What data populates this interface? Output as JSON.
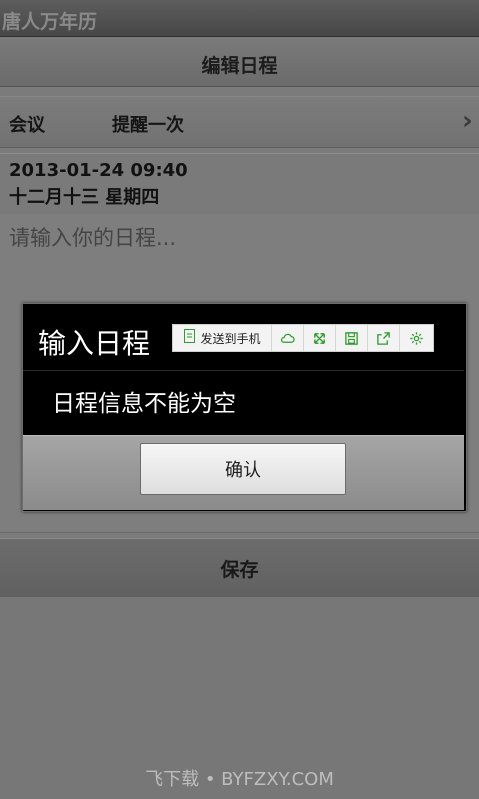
{
  "app": {
    "title": "唐人万年历"
  },
  "header": {
    "title": "编辑日程"
  },
  "event": {
    "type": "会议",
    "remind": "提醒一次",
    "date_line1": "2013-01-24 09:40",
    "date_line2": "十二月十三 星期四"
  },
  "editor": {
    "placeholder": "请输入你的日程..."
  },
  "save": {
    "label": "保存"
  },
  "dialog": {
    "title": "输入日程",
    "message": "日程信息不能为空",
    "confirm_label": "确认",
    "toolbar": {
      "send_label": "发送到手机",
      "icons": [
        "send-to-phone-icon",
        "cloud-icon",
        "expand-icon",
        "save-icon",
        "share-icon",
        "settings-icon"
      ]
    }
  },
  "watermark": "飞下载 • BYFZXY.COM",
  "colors": {
    "toolbar_icon": "#2d9b2d",
    "dialog_bg": "#000000"
  }
}
